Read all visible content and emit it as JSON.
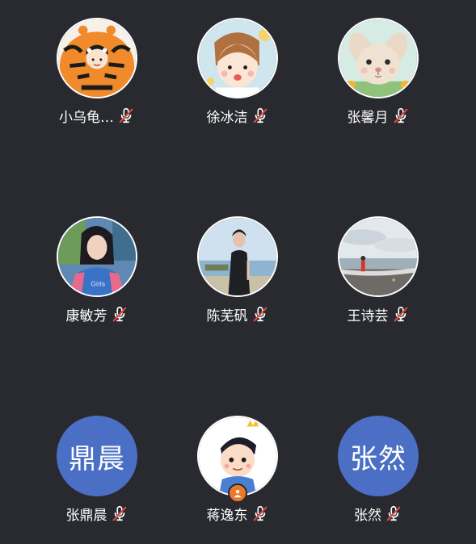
{
  "participants": [
    {
      "name": "小乌龟…",
      "avatar": "tiger-cartoon",
      "muted": true
    },
    {
      "name": "徐冰洁",
      "avatar": "girl-cartoon",
      "muted": true
    },
    {
      "name": "张馨月",
      "avatar": "bunny-cartoon",
      "muted": true
    },
    {
      "name": "康敏芳",
      "avatar": "girl-photo",
      "muted": true
    },
    {
      "name": "陈芜矾",
      "avatar": "man-photo",
      "muted": true
    },
    {
      "name": "王诗芸",
      "avatar": "beach-photo",
      "muted": true
    },
    {
      "name": "张鼎晨",
      "avatar_text": "鼎晨",
      "muted": true
    },
    {
      "name": "蒋逸东",
      "avatar": "prince-cartoon",
      "muted": true,
      "host": true
    },
    {
      "name": "张然",
      "avatar_text": "张然",
      "muted": true
    }
  ],
  "colors": {
    "background": "#282a30",
    "text_avatar": "#4a6fc4",
    "mute_slash": "#e8483c",
    "host_badge": "#ea7a2a"
  }
}
